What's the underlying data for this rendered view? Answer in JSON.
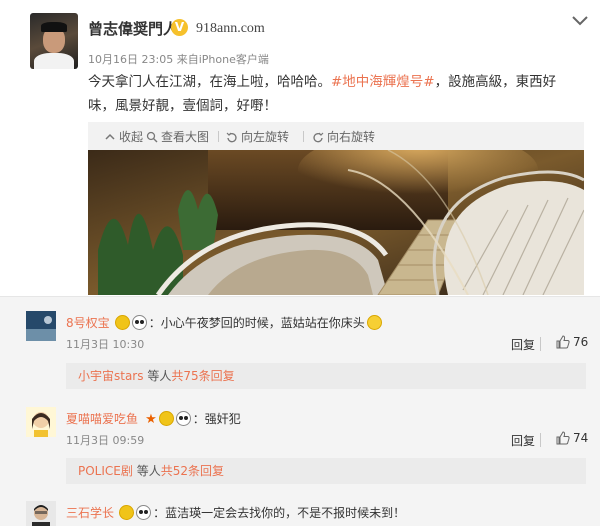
{
  "post": {
    "user_name": "曾志偉奨門人",
    "verified_icon": "v-badge-icon",
    "watermark": "918ann.com",
    "time": "10月16日 23:05",
    "source_prefix": "来自",
    "source": "iPhone客户端",
    "text_before": "今天拿门人在江湖，在海上啦，哈哈哈。",
    "hashtag": "#地中海輝煌号#",
    "text_after": "，設施高級，東西好味，風景好靚，壹個詞，好嘢！",
    "toolbar": {
      "collapse": "收起",
      "view_large": "查看大图",
      "rotate_left": "向左旋转",
      "rotate_right": "向右旋转"
    }
  },
  "comments": [
    {
      "name": "8号权宝",
      "text": "：小心午夜梦回的时候，蓝姑站在你床头",
      "time": "11月3日 10:30",
      "reply": "回复",
      "likes": "76",
      "sub_name": "小宇宙stars",
      "sub_mid": "等人",
      "sub_count": "共75条回复"
    },
    {
      "name": "夏喵喵爱吃鱼",
      "text": "：强奸犯",
      "time": "11月3日 09:59",
      "reply": "回复",
      "likes": "74",
      "sub_name": "POLICE剧",
      "sub_mid": "等人",
      "sub_count": "共52条回复"
    },
    {
      "name": "三石学长",
      "text": "：蓝洁瑛一定会去找你的，不是不报时候未到！"
    }
  ],
  "colors": {
    "accent": "#eb7350",
    "comment_bg": "#f4f4f4",
    "sub_bg": "#ebebeb"
  }
}
